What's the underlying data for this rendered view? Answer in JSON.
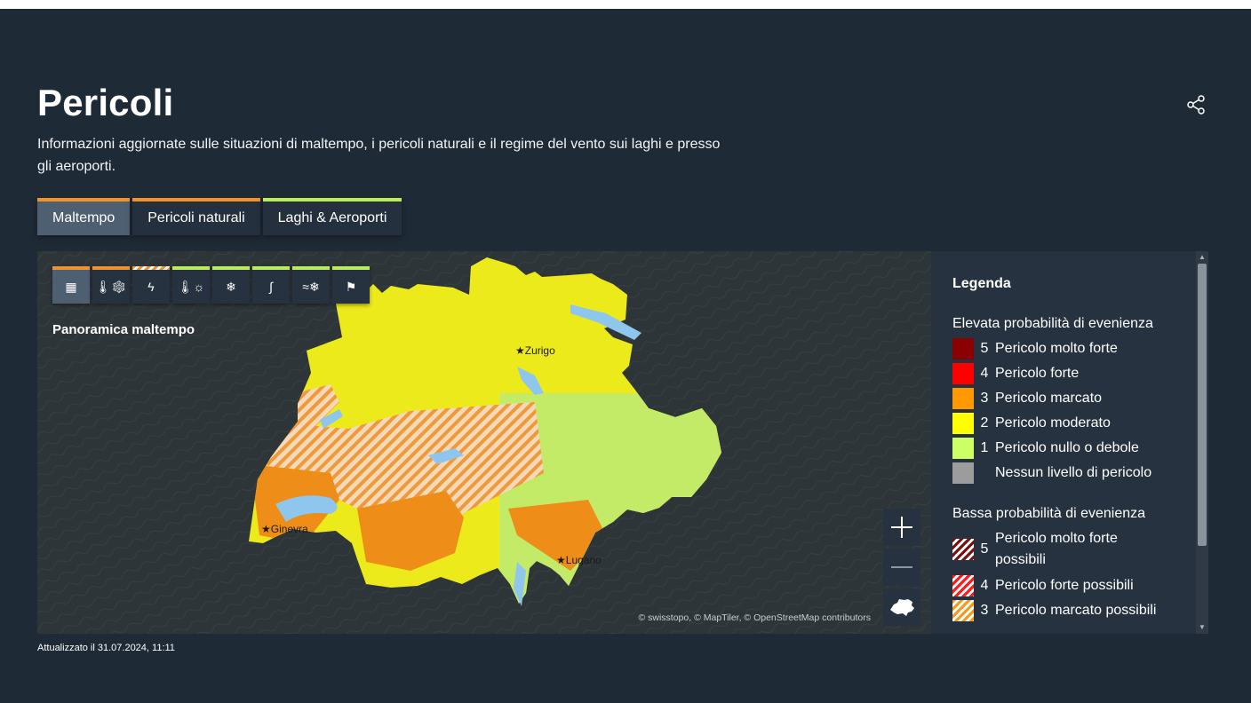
{
  "page": {
    "title": "Pericoli",
    "subtitle": "Informazioni aggiornate sulle situazioni di maltempo, i pericoli naturali e il regime del vento sui laghi e presso gli aeroporti.",
    "updated": "Attualizzato il 31.07.2024, 11:11"
  },
  "header": {
    "share_icon": "share-icon"
  },
  "tabs": [
    {
      "label": "Maltempo",
      "color": "#f2922b",
      "active": true
    },
    {
      "label": "Pericoli naturali",
      "color": "#f2922b",
      "active": false
    },
    {
      "label": "Laghi & Aeroporti",
      "color": "#b8ee5a",
      "active": false
    }
  ],
  "map": {
    "label": "Panoramica maltempo",
    "attribution": "© swisstopo, © MapTiler, © OpenStreetMap contributors",
    "cities": [
      "Zurigo",
      "Ginevra",
      "Lugano"
    ],
    "toolbar": [
      {
        "icon": "grid-icon",
        "color": "#f2922b",
        "active": true
      },
      {
        "icon": "thermometer-snow-icon",
        "color": "#f2922b"
      },
      {
        "icon": "lightning-icon",
        "color": "hatched-orange"
      },
      {
        "icon": "thermometer-sun-icon",
        "color": "#b8ee5a"
      },
      {
        "icon": "snowflake-icon",
        "color": "#b8ee5a"
      },
      {
        "icon": "slippery-road-icon",
        "color": "#b8ee5a"
      },
      {
        "icon": "wind-snow-icon",
        "color": "#b8ee5a"
      },
      {
        "icon": "windsock-icon",
        "color": "#b8ee5a"
      }
    ],
    "controls": [
      "zoom-in-icon",
      "zoom-out-icon",
      "switzerland-icon"
    ]
  },
  "legend": {
    "title": "Legenda",
    "high_heading": "Elevata probabilità di evenienza",
    "high": [
      {
        "num": "5",
        "label": "Pericolo molto forte",
        "color": "#8b0000"
      },
      {
        "num": "4",
        "label": "Pericolo forte",
        "color": "#ff0000"
      },
      {
        "num": "3",
        "label": "Pericolo marcato",
        "color": "#ff9900"
      },
      {
        "num": "2",
        "label": "Pericolo moderato",
        "color": "#ffff00"
      },
      {
        "num": "1",
        "label": "Pericolo nullo o debole",
        "color": "#ccff66"
      },
      {
        "num": "",
        "label": "Nessun livello di pericolo",
        "color": "#9c9c9c"
      }
    ],
    "low_heading": "Bassa probabilità di evenienza",
    "low": [
      {
        "num": "5",
        "label_line1": "Pericolo molto forte",
        "label_line2": "possibili"
      },
      {
        "num": "4",
        "label": "Pericolo forte possibili"
      },
      {
        "num": "3",
        "label": "Pericolo marcato possibili"
      }
    ]
  }
}
